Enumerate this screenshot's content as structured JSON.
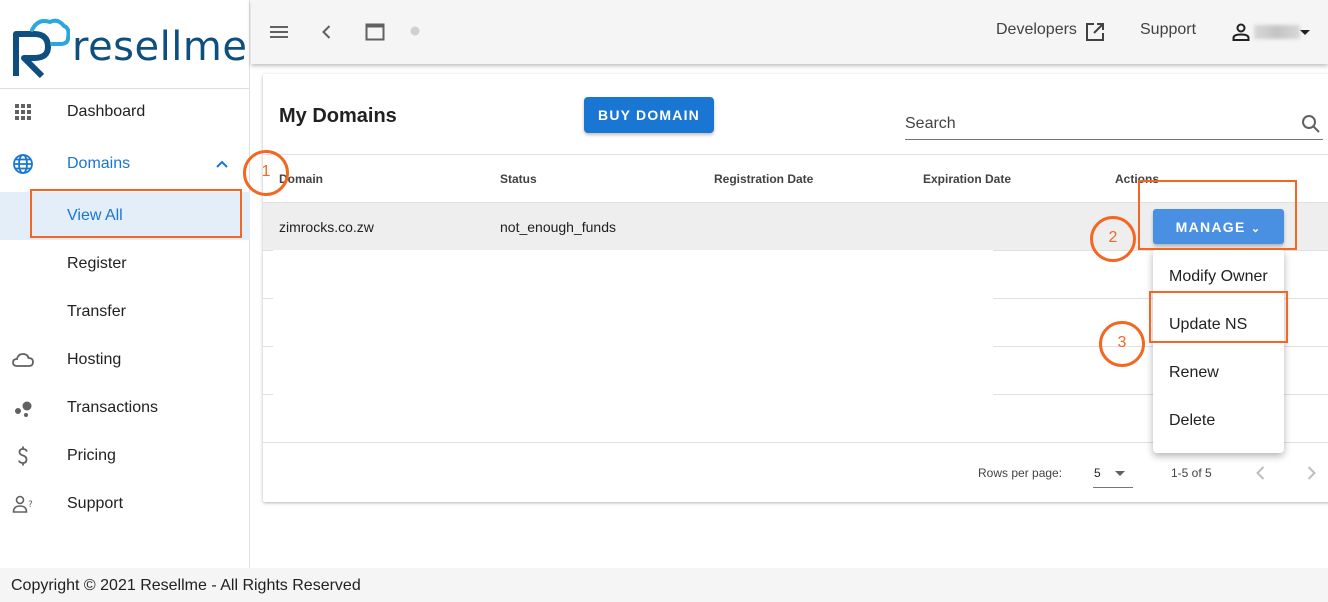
{
  "brand": {
    "name": "resellme",
    "logo_letter": "R"
  },
  "sidebar": {
    "items": [
      {
        "label": "Dashboard",
        "icon": "grid-icon"
      },
      {
        "label": "Domains",
        "icon": "globe-icon"
      },
      {
        "label": "View All"
      },
      {
        "label": "Register"
      },
      {
        "label": "Transfer"
      },
      {
        "label": "Hosting",
        "icon": "cloud-icon"
      },
      {
        "label": "Transactions",
        "icon": "bubble-chart-icon"
      },
      {
        "label": "Pricing",
        "icon": "dollar-icon"
      },
      {
        "label": "Support",
        "icon": "contact-support-icon"
      }
    ]
  },
  "topbar": {
    "developers_label": "Developers",
    "support_label": "Support"
  },
  "main": {
    "title": "My Domains",
    "buy_button": "BUY DOMAIN",
    "search_placeholder": "Search",
    "table": {
      "headers": [
        "Domain",
        "Status",
        "Registration Date",
        "Expiration Date",
        "Actions"
      ],
      "rows": [
        {
          "domain": "zimrocks.co.zw",
          "status": "not_enough_funds",
          "registration_date": "",
          "expiration_date": ""
        }
      ]
    },
    "manage_button": "MANAGE",
    "menu": [
      "Modify Owner",
      "Update NS",
      "Renew",
      "Delete"
    ],
    "pagination": {
      "rows_per_page_label": "Rows per page:",
      "rows_per_page": "5",
      "range": "1-5 of 5"
    }
  },
  "annotations": [
    "1",
    "2",
    "3"
  ],
  "colors": {
    "primary": "#1976d2",
    "manage": "#4a90e2",
    "annotation": "#f26722",
    "brand": "#0e4f7f"
  },
  "footer": {
    "copyright": "Copyright © 2021 Resellme - All Rights Reserved"
  }
}
